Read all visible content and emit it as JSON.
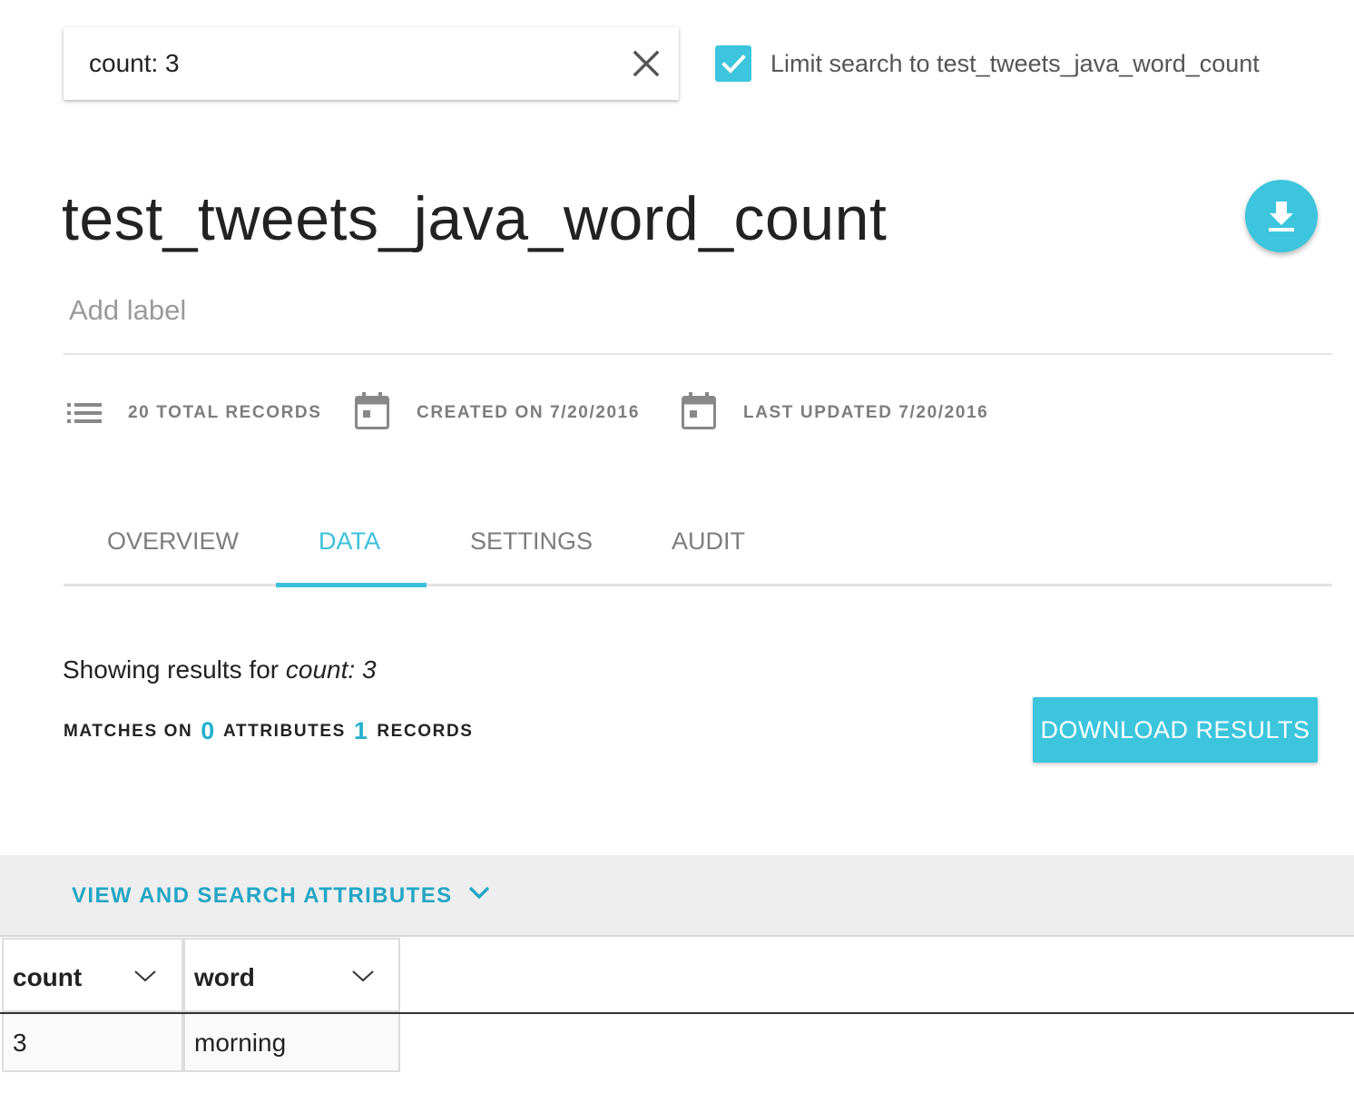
{
  "search": {
    "query": "count: 3",
    "limit_checked": true,
    "limit_label": "Limit search to test_tweets_java_word_count"
  },
  "dataset": {
    "title": "test_tweets_java_word_count",
    "add_label_placeholder": "Add label",
    "total_records": "20 TOTAL RECORDS",
    "created_on": "CREATED ON 7/20/2016",
    "last_updated": "LAST UPDATED 7/20/2016"
  },
  "tabs": [
    {
      "label": "OVERVIEW",
      "active": false
    },
    {
      "label": "DATA",
      "active": true
    },
    {
      "label": "SETTINGS",
      "active": false
    },
    {
      "label": "AUDIT",
      "active": false
    }
  ],
  "results": {
    "prefix": "Showing results for ",
    "query": "count: 3",
    "matches_on_label": "MATCHES ON",
    "attributes_count": "0",
    "attributes_label": "ATTRIBUTES",
    "records_count": "1",
    "records_label": "RECORDS",
    "download_button": "DOWNLOAD RESULTS"
  },
  "attributes_toggle": "VIEW AND SEARCH ATTRIBUTES",
  "table": {
    "columns": [
      "count",
      "word"
    ],
    "rows": [
      [
        "3",
        "morning"
      ]
    ]
  },
  "colors": {
    "accent": "#3cc5dd",
    "accent_text": "#23b0cc"
  },
  "icons": {
    "clear": "close-icon",
    "checkbox": "check-icon",
    "download": "download-icon",
    "records": "list-icon",
    "calendar": "calendar-icon",
    "toggle": "chevron-down-icon",
    "column_menu": "chevron-down-icon"
  }
}
